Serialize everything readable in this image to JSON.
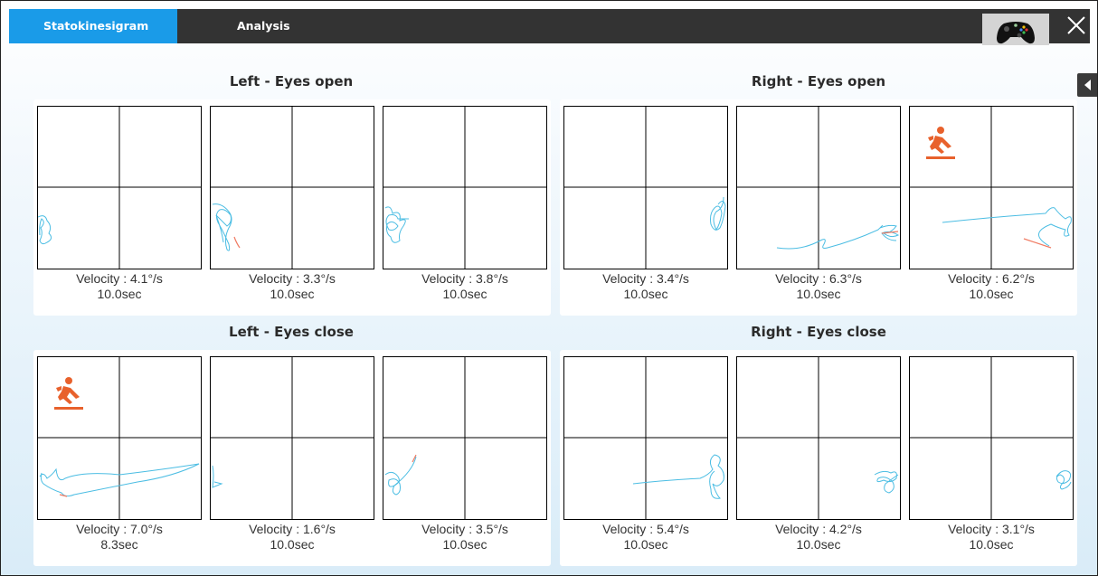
{
  "tabs": [
    {
      "label": "Statokinesigram",
      "active": true
    },
    {
      "label": "Analysis",
      "active": false
    }
  ],
  "icons": {
    "gamepad": "gamepad-icon",
    "close": "close-icon",
    "side_toggle": "caret-left-icon",
    "fall": "fall-warning-icon"
  },
  "colors": {
    "accent": "#1a9be8",
    "trace": "#4bbde3",
    "trace_end": "#f07b63",
    "fall": "#e8612c",
    "topbar": "#333333"
  },
  "groups": [
    {
      "title": "Left - Eyes open",
      "tests": [
        {
          "velocity": "Velocity : 4.1°/s",
          "duration": "10.0sec",
          "fall": false
        },
        {
          "velocity": "Velocity : 3.3°/s",
          "duration": "10.0sec",
          "fall": false
        },
        {
          "velocity": "Velocity : 3.8°/s",
          "duration": "10.0sec",
          "fall": false
        }
      ]
    },
    {
      "title": "Right - Eyes open",
      "tests": [
        {
          "velocity": "Velocity : 3.4°/s",
          "duration": "10.0sec",
          "fall": false
        },
        {
          "velocity": "Velocity : 6.3°/s",
          "duration": "10.0sec",
          "fall": false
        },
        {
          "velocity": "Velocity : 6.2°/s",
          "duration": "10.0sec",
          "fall": true
        }
      ]
    },
    {
      "title": "Left - Eyes close",
      "tests": [
        {
          "velocity": "Velocity : 7.0°/s",
          "duration": "8.3sec",
          "fall": true
        },
        {
          "velocity": "Velocity : 1.6°/s",
          "duration": "10.0sec",
          "fall": false
        },
        {
          "velocity": "Velocity : 3.5°/s",
          "duration": "10.0sec",
          "fall": false
        }
      ]
    },
    {
      "title": "Right - Eyes close",
      "tests": [
        {
          "velocity": "Velocity : 5.4°/s",
          "duration": "10.0sec",
          "fall": false
        },
        {
          "velocity": "Velocity : 4.2°/s",
          "duration": "10.0sec",
          "fall": false
        },
        {
          "velocity": "Velocity : 3.1°/s",
          "duration": "10.0sec",
          "fall": false
        }
      ]
    }
  ]
}
